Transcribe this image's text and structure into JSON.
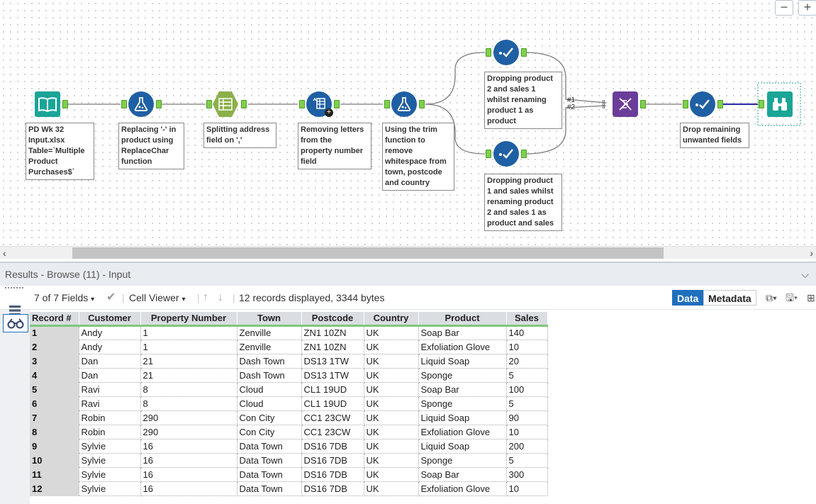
{
  "canvas": {
    "zoom_out_label": "−",
    "zoom_in_label": "+",
    "union_labels": [
      "#1",
      "#2"
    ],
    "tools": [
      {
        "name": "input-data-tool",
        "icon": "book-icon",
        "color": "#1aa597"
      },
      {
        "name": "formula-tool-replace",
        "icon": "flask-icon",
        "color": "#1f5fa3"
      },
      {
        "name": "text-to-columns-tool",
        "icon": "columns-icon",
        "color": "#8bb04a"
      },
      {
        "name": "multi-field-formula-tool",
        "icon": "multi-field-icon",
        "color": "#1f5fa3"
      },
      {
        "name": "formula-tool-trim",
        "icon": "flask-icon",
        "color": "#1f5fa3"
      },
      {
        "name": "select-tool-1",
        "icon": "select-check-icon",
        "color": "#1f5fa3"
      },
      {
        "name": "select-tool-2",
        "icon": "select-check-icon",
        "color": "#1f5fa3"
      },
      {
        "name": "union-tool",
        "icon": "dna-icon",
        "color": "#6b3d9a"
      },
      {
        "name": "select-tool-3",
        "icon": "select-check-icon",
        "color": "#1f5fa3"
      },
      {
        "name": "browse-tool",
        "icon": "binoculars-icon",
        "color": "#1aa597"
      }
    ],
    "annotations": [
      "PD Wk 32\nInput.xlsx\nTable=`Multiple\nProduct\nPurchases$`",
      "Replacing '-' in\nproduct using\nReplaceChar\nfunction",
      "Splitting address\nfield on ','",
      "Removing letters\nfrom the\nproperty number\nfield",
      "Using the trim\nfunction to\nremove\nwhitespace from\ntown, postcode\nand country",
      "Dropping product\n2 and sales 1\nwhilst renaming\nproduct 1 as\nproduct",
      "Dropping product\n1 and sales whilst\nrenaming product\n2 and sales 1 as\nproduct and sales",
      "Drop remaining\nunwanted fields"
    ]
  },
  "results": {
    "header_title": "Results - Browse (11) - Input",
    "fields_label": "7 of 7 Fields",
    "viewer_label": "Cell Viewer",
    "records_info": "12 records displayed, 3344 bytes",
    "tab_data": "Data",
    "tab_metadata": "Metadata"
  },
  "table": {
    "columns": [
      "Record #",
      "Customer",
      "Property Number",
      "Town",
      "Postcode",
      "Country",
      "Product",
      "Sales"
    ],
    "rows": [
      [
        "1",
        "Andy",
        "1",
        "Zenville",
        "ZN1 10ZN",
        "UK",
        "Soap Bar",
        "140"
      ],
      [
        "2",
        "Andy",
        "1",
        "Zenville",
        "ZN1 10ZN",
        "UK",
        "Exfoliation Glove",
        "10"
      ],
      [
        "3",
        "Dan",
        "21",
        "Dash Town",
        "DS13 1TW",
        "UK",
        "Liquid Soap",
        "20"
      ],
      [
        "4",
        "Dan",
        "21",
        "Dash Town",
        "DS13 1TW",
        "UK",
        "Sponge",
        "5"
      ],
      [
        "5",
        "Ravi",
        "8",
        "Cloud",
        "CL1 19UD",
        "UK",
        "Soap Bar",
        "100"
      ],
      [
        "6",
        "Ravi",
        "8",
        "Cloud",
        "CL1 19UD",
        "UK",
        "Sponge",
        "5"
      ],
      [
        "7",
        "Robin",
        "290",
        "Con City",
        "CC1 23CW",
        "UK",
        "Liquid Soap",
        "90"
      ],
      [
        "8",
        "Robin",
        "290",
        "Con City",
        "CC1 23CW",
        "UK",
        "Exfoliation Glove",
        "10"
      ],
      [
        "9",
        "Sylvie",
        "16",
        "Data Town",
        "DS16 7DB",
        "UK",
        "Liquid Soap",
        "200"
      ],
      [
        "10",
        "Sylvie",
        "16",
        "Data Town",
        "DS16 7DB",
        "UK",
        "Sponge",
        "5"
      ],
      [
        "11",
        "Sylvie",
        "16",
        "Data Town",
        "DS16 7DB",
        "UK",
        "Soap Bar",
        "300"
      ],
      [
        "12",
        "Sylvie",
        "16",
        "Data Town",
        "DS16 7DB",
        "UK",
        "Exfoliation Glove",
        "10"
      ]
    ]
  }
}
